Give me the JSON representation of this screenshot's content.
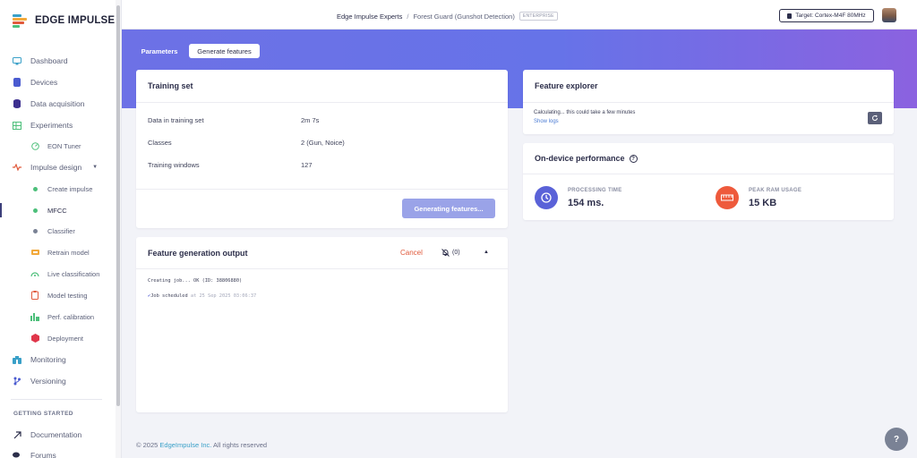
{
  "app": {
    "logo_text": "EDGE IMPULSE"
  },
  "sidebar": {
    "items": [
      {
        "label": "Dashboard",
        "icon": "monitor-icon"
      },
      {
        "label": "Devices",
        "icon": "devices-icon"
      },
      {
        "label": "Data acquisition",
        "icon": "database-icon"
      },
      {
        "label": "Experiments",
        "icon": "grid-icon"
      },
      {
        "label": "EON Tuner",
        "icon": "tuner-icon"
      },
      {
        "label": "Impulse design",
        "icon": "pulse-icon"
      },
      {
        "label": "Create impulse",
        "icon": "dot-icon"
      },
      {
        "label": "MFCC",
        "icon": "dot-icon"
      },
      {
        "label": "Classifier",
        "icon": "dot-icon"
      },
      {
        "label": "Retrain model",
        "icon": "retrain-icon"
      },
      {
        "label": "Live classification",
        "icon": "live-icon"
      },
      {
        "label": "Model testing",
        "icon": "clipboard-icon"
      },
      {
        "label": "Perf. calibration",
        "icon": "calibration-icon"
      },
      {
        "label": "Deployment",
        "icon": "cube-icon"
      },
      {
        "label": "Monitoring",
        "icon": "monitoring-icon"
      },
      {
        "label": "Versioning",
        "icon": "branch-icon"
      }
    ],
    "section_getting_started": "GETTING STARTED",
    "bottom_items": [
      {
        "label": "Documentation",
        "icon": "docs-icon"
      },
      {
        "label": "Forums",
        "icon": "forum-icon"
      }
    ]
  },
  "topbar": {
    "org": "Edge Impulse Experts",
    "separator": "/",
    "project": "Forest Guard (Gunshot Detection)",
    "badge": "ENTERPRISE",
    "target": "Target: Cortex-M4F 80MHz"
  },
  "tabs": {
    "parameters": "Parameters",
    "generate": "Generate features"
  },
  "training_set": {
    "title": "Training set",
    "rows": [
      {
        "label": "Data in training set",
        "value": "2m 7s"
      },
      {
        "label": "Classes",
        "value": "2 (Gun, Noice)"
      },
      {
        "label": "Training windows",
        "value": "127"
      }
    ],
    "button": "Generating features..."
  },
  "feature_output": {
    "title": "Feature generation output",
    "cancel": "Cancel",
    "notif_count": "(0)",
    "log_lines": [
      {
        "text": "Creating job... OK (ID: 38806880)",
        "ts": ""
      },
      {
        "text": "Job scheduled",
        "ts": "at 25 Sep 2025 03:06:37"
      }
    ]
  },
  "feature_explorer": {
    "title": "Feature explorer",
    "status": "Calculating... this could take a few minutes",
    "show_logs": "Show logs"
  },
  "performance": {
    "title": "On-device performance",
    "processing_label": "PROCESSING TIME",
    "processing_value": "154 ms.",
    "ram_label": "PEAK RAM USAGE",
    "ram_value": "15 KB"
  },
  "footer": {
    "copyright": "© 2025",
    "company": "EdgeImpulse Inc.",
    "rights": "All rights reserved"
  },
  "colors": {
    "accent": "#6d71e6",
    "cancel": "#e05a3c",
    "processing": "#5a62d8",
    "ram": "#ee5a3c"
  }
}
